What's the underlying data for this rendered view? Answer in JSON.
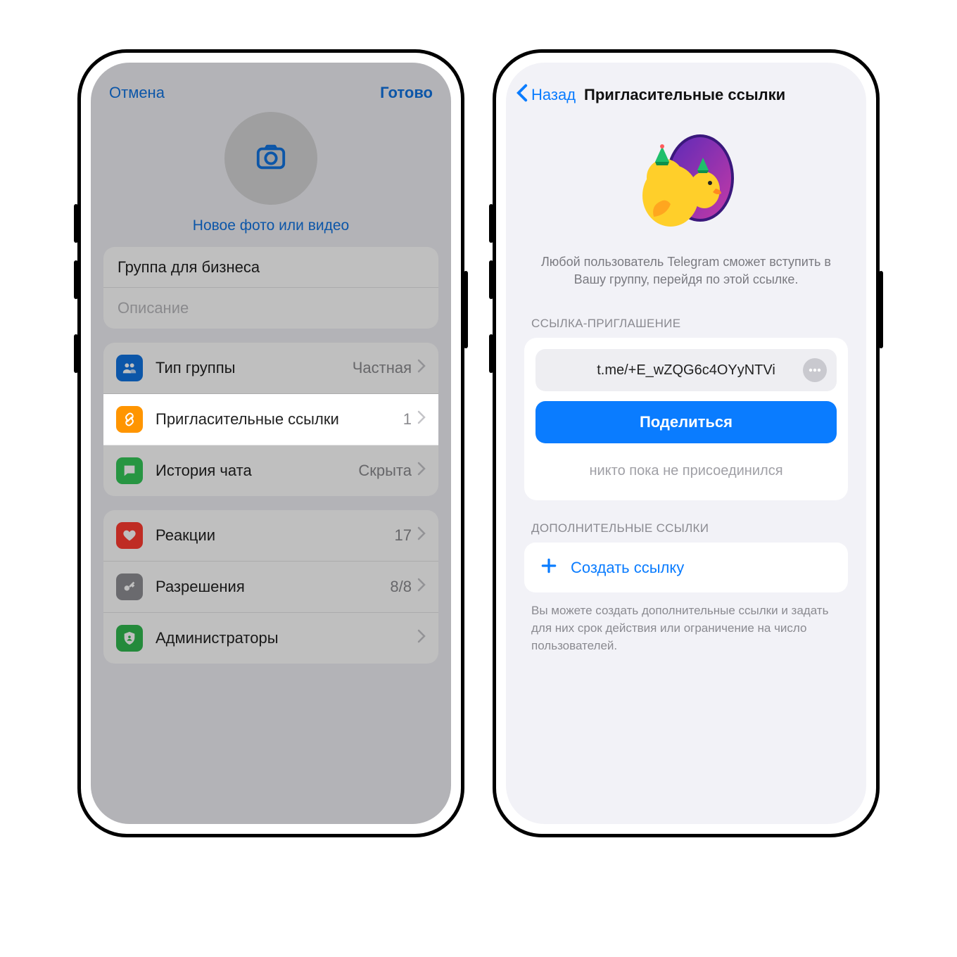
{
  "left": {
    "cancel": "Отмена",
    "done": "Готово",
    "new_photo": "Новое фото или видео",
    "group_name_value": "Группа для бизнеса",
    "desc_placeholder": "Описание",
    "rows1": {
      "type_label": "Тип группы",
      "type_value": "Частная",
      "invite_label": "Пригласительные ссылки",
      "invite_value": "1",
      "history_label": "История чата",
      "history_value": "Скрыта"
    },
    "rows2": {
      "reactions_label": "Реакции",
      "reactions_value": "17",
      "perm_label": "Разрешения",
      "perm_value": "8/8",
      "admins_label": "Администраторы"
    }
  },
  "right": {
    "back": "Назад",
    "title": "Пригласительные ссылки",
    "caption": "Любой пользователь Telegram сможет вступить в Вашу группу, перейдя по этой ссылке.",
    "section_link_hdr": "ССЫЛКА-ПРИГЛАШЕНИЕ",
    "link_text": "t.me/+E_wZQG6c4OYyNTVi",
    "share": "Поделиться",
    "nobody": "никто пока не присоединился",
    "section_extra_hdr": "ДОПОЛНИТЕЛЬНЫЕ ССЫЛКИ",
    "create_link": "Создать ссылку",
    "footer": "Вы можете создать дополнительные ссылки и задать для них срок действия или ограничение на число пользователей."
  },
  "colors": {
    "icon_blue": "#1173e0",
    "icon_orange": "#ff9500",
    "icon_green": "#34c759",
    "icon_red": "#ff3b30",
    "icon_grey": "#8e8e93",
    "icon_green2": "#30b94f"
  }
}
